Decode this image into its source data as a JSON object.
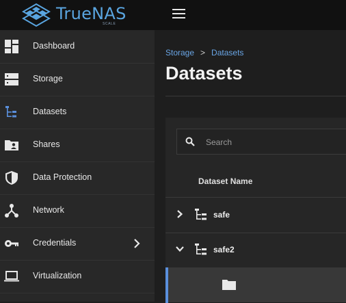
{
  "app": {
    "name": "TrueNAS",
    "edition": "SCALE",
    "accent_color": "#5a8fdc"
  },
  "sidebar": {
    "items": [
      {
        "label": "Dashboard",
        "icon": "dashboard-icon"
      },
      {
        "label": "Storage",
        "icon": "storage-icon"
      },
      {
        "label": "Datasets",
        "icon": "datasets-icon",
        "active": true
      },
      {
        "label": "Shares",
        "icon": "shares-folder-icon"
      },
      {
        "label": "Data Protection",
        "icon": "shield-icon"
      },
      {
        "label": "Network",
        "icon": "network-icon"
      },
      {
        "label": "Credentials",
        "icon": "key-icon",
        "has_submenu": true
      },
      {
        "label": "Virtualization",
        "icon": "laptop-icon"
      }
    ]
  },
  "breadcrumb": {
    "items": [
      "Storage",
      "Datasets"
    ],
    "separator": ">"
  },
  "page": {
    "title": "Datasets"
  },
  "search": {
    "placeholder": "Search",
    "value": ""
  },
  "table": {
    "column_header": "Dataset Name",
    "rows": [
      {
        "name": "safe",
        "expanded": false
      },
      {
        "name": "safe2",
        "expanded": true
      },
      {
        "name": "",
        "selected": true,
        "child": true,
        "icon": "folder-icon"
      }
    ]
  }
}
